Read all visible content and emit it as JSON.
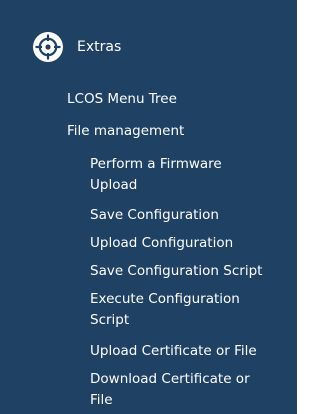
{
  "sidebar": {
    "section": {
      "label": "Extras",
      "icon": "crosshair-target-icon"
    },
    "items": [
      {
        "label": "LCOS Menu Tree",
        "level": 1
      },
      {
        "label": "File management",
        "level": 1
      },
      {
        "label": "Perform a Firmware",
        "label_cont": "Upload",
        "level": 2
      },
      {
        "label": "Save Configuration",
        "level": 2
      },
      {
        "label": "Upload Configuration",
        "level": 2
      },
      {
        "label": "Save Configuration Script",
        "level": 2
      },
      {
        "label": "Execute Configuration",
        "label_cont": "Script",
        "level": 2
      },
      {
        "label": "Upload Certificate or File",
        "level": 2
      },
      {
        "label": "Download Certificate or",
        "label_cont": "File",
        "level": 2
      }
    ]
  }
}
